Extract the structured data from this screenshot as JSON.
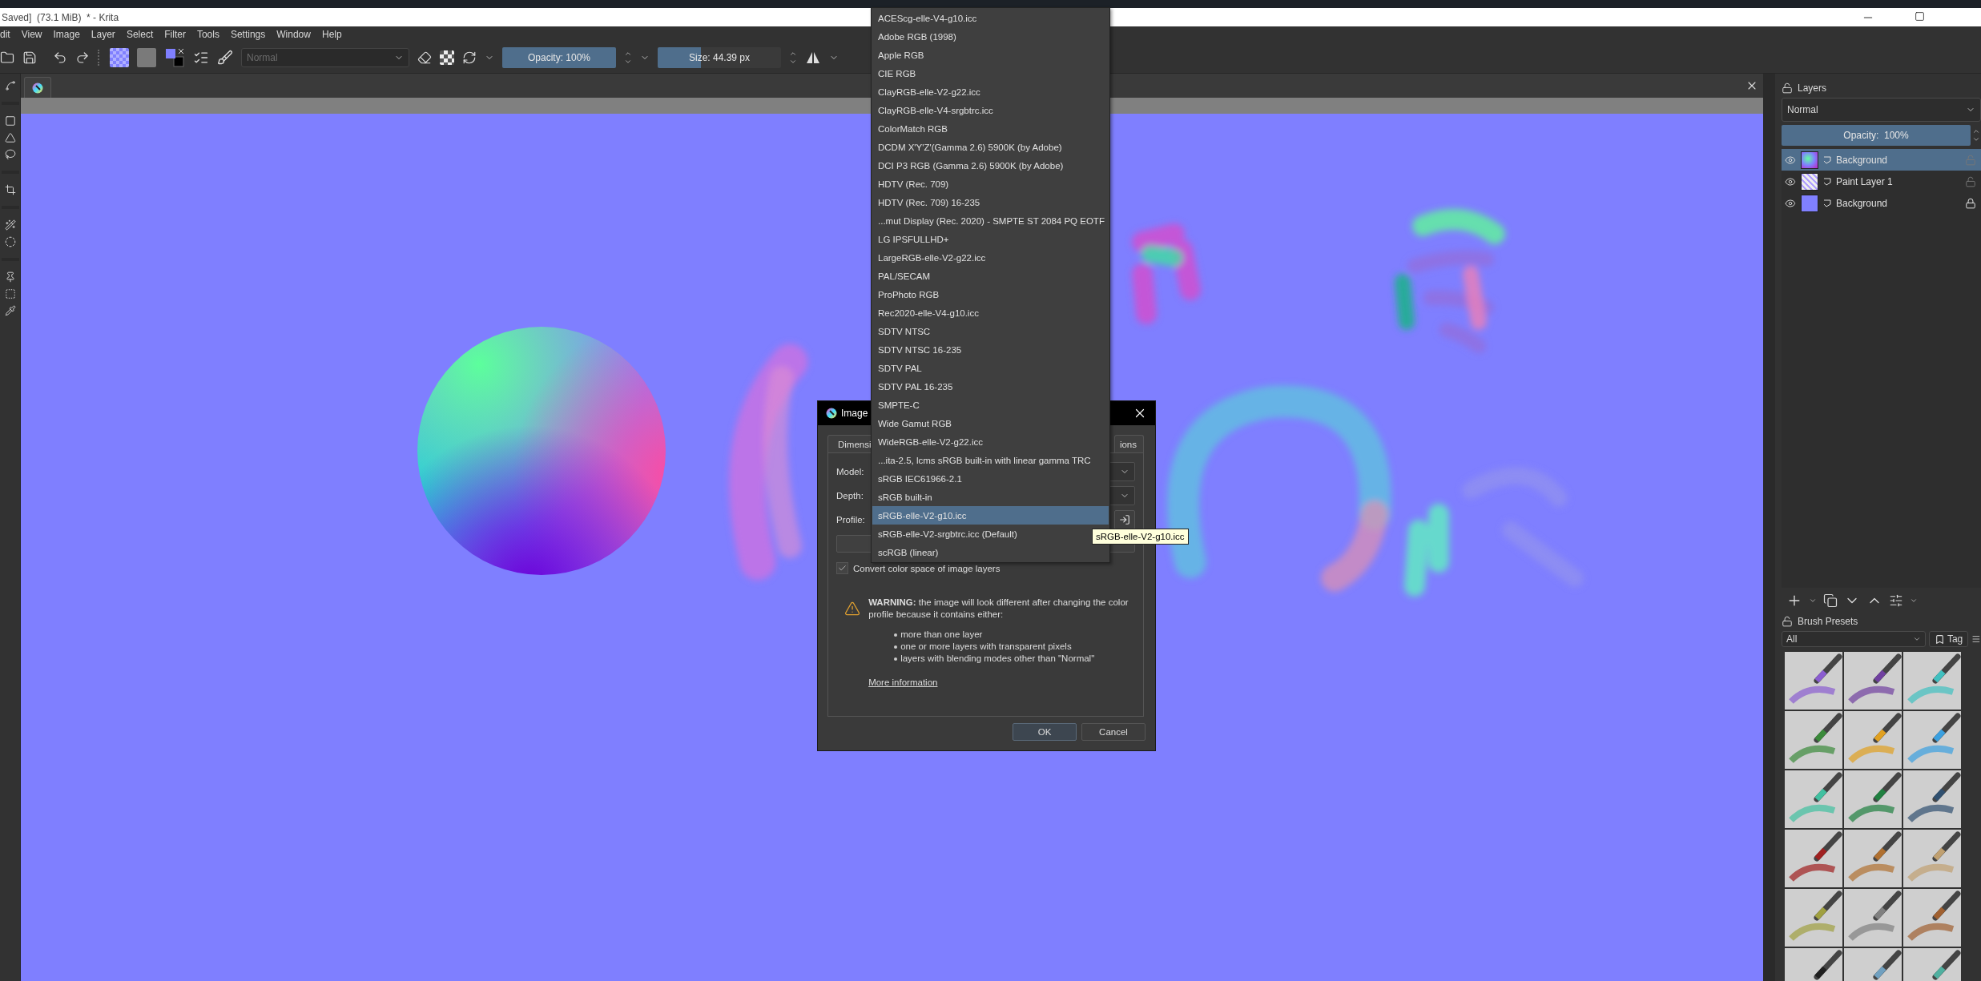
{
  "window": {
    "title": "Saved]  (73.1 MiB)  * - Krita"
  },
  "menu": [
    "dit",
    "View",
    "Image",
    "Layer",
    "Select",
    "Filter",
    "Tools",
    "Settings",
    "Window",
    "Help"
  ],
  "toolbar": {
    "blend_mode": {
      "value": "Normal",
      "disabled": true
    },
    "opacity": {
      "label": "Opacity: 100%",
      "level": 1
    },
    "size": {
      "label": "Size: 44.39 px",
      "level": 0.35
    }
  },
  "layers_docker": {
    "title": "Layers",
    "blend_mode": "Normal",
    "opacity": {
      "label": "Opacity:  100%",
      "level": 1
    },
    "layers": [
      {
        "name": "Background",
        "kind": "sphere",
        "selected": true,
        "locked": false
      },
      {
        "name": "Paint Layer 1",
        "kind": "strokes",
        "selected": false,
        "locked": false
      },
      {
        "name": "Background",
        "kind": "fill",
        "selected": false,
        "locked": true
      }
    ]
  },
  "brush_presets": {
    "title": "Brush Presets",
    "filter": "All",
    "tag_button": "Tag"
  },
  "dialog": {
    "title": "Image",
    "tabs": [
      "Dimensi",
      "ions"
    ],
    "fields": [
      "Model:",
      "Depth:",
      "Profile:"
    ],
    "convert_checkbox": {
      "label": "Convert color space of image layers",
      "checked": true
    },
    "warning": {
      "text": "**WARNING:** the image will look different after changing the color profile because it contains either:",
      "bullets": [
        "more than one layer",
        "one or more layers with transparent pixels",
        "layers with blending modes other than \"Normal\""
      ],
      "link": "More information"
    },
    "buttons": [
      {
        "label": "OK",
        "default": true
      },
      {
        "label": "Cancel",
        "default": false
      }
    ]
  },
  "profile_dropdown": {
    "items": [
      {
        "label": "ACEScg-elle-V4-g10.icc",
        "selected": false
      },
      {
        "label": "Adobe RGB (1998)",
        "selected": false
      },
      {
        "label": "Apple RGB",
        "selected": false
      },
      {
        "label": "CIE RGB",
        "selected": false
      },
      {
        "label": "ClayRGB-elle-V2-g22.icc",
        "selected": false
      },
      {
        "label": "ClayRGB-elle-V4-srgbtrc.icc",
        "selected": false
      },
      {
        "label": "ColorMatch RGB",
        "selected": false
      },
      {
        "label": "DCDM X'Y'Z'(Gamma 2.6) 5900K (by Adobe)",
        "selected": false
      },
      {
        "label": "DCI P3 RGB (Gamma 2.6) 5900K (by Adobe)",
        "selected": false
      },
      {
        "label": "HDTV (Rec. 709)",
        "selected": false
      },
      {
        "label": "HDTV (Rec. 709) 16-235",
        "selected": false
      },
      {
        "label": "...mut Display (Rec. 2020) - SMPTE ST 2084 PQ EOTF",
        "selected": false
      },
      {
        "label": "LG IPSFULLHD+",
        "selected": false
      },
      {
        "label": "LargeRGB-elle-V2-g22.icc",
        "selected": false
      },
      {
        "label": "PAL/SECAM",
        "selected": false
      },
      {
        "label": "ProPhoto RGB",
        "selected": false
      },
      {
        "label": "Rec2020-elle-V4-g10.icc",
        "selected": false
      },
      {
        "label": "SDTV NTSC",
        "selected": false
      },
      {
        "label": "SDTV NTSC 16-235",
        "selected": false
      },
      {
        "label": "SDTV PAL",
        "selected": false
      },
      {
        "label": "SDTV PAL 16-235",
        "selected": false
      },
      {
        "label": "SMPTE-C",
        "selected": false
      },
      {
        "label": "Wide Gamut RGB",
        "selected": false
      },
      {
        "label": "WideRGB-elle-V2-g22.icc",
        "selected": false
      },
      {
        "label": "...ita-2.5, lcms sRGB built-in with linear gamma TRC",
        "selected": false
      },
      {
        "label": "sRGB IEC61966-2.1",
        "selected": false
      },
      {
        "label": "sRGB built-in",
        "selected": false
      },
      {
        "label": "sRGB-elle-V2-g10.icc",
        "selected": true
      },
      {
        "label": "sRGB-elle-V2-srgbtrc.icc (Default)",
        "selected": false
      },
      {
        "label": "scRGB (linear)",
        "selected": false
      }
    ]
  },
  "tooltip": "sRGB-elle-V2-g10.icc"
}
